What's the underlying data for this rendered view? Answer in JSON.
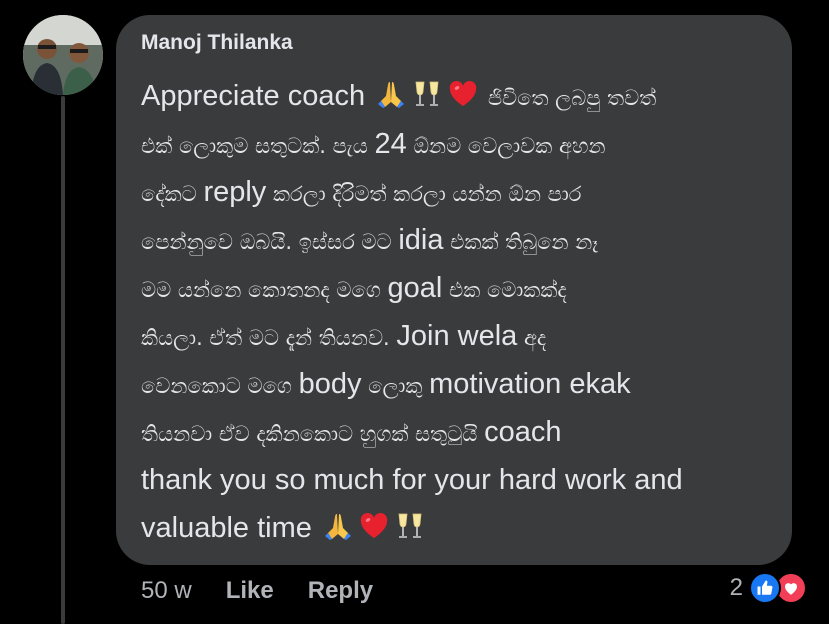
{
  "comment": {
    "author": "Manoj Thilanka",
    "lines": [
      {
        "parts": [
          {
            "type": "text",
            "value": "Appreciate coach "
          },
          {
            "type": "emoji",
            "icon": "folded-hands-icon"
          },
          {
            "type": "emoji",
            "icon": "champagne-glasses-icon"
          },
          {
            "type": "emoji",
            "icon": "red-heart-icon"
          },
          {
            "type": "sin",
            "value": "  ජිවිතෙ ලබපු තවත්"
          }
        ]
      },
      {
        "parts": [
          {
            "type": "sin",
            "value": "එක් ලොකුම සතුටක්.  පැය "
          },
          {
            "type": "text",
            "value": "24"
          },
          {
            "type": "sin",
            "value": " ඕනම වෙලාවක අහන"
          }
        ]
      },
      {
        "parts": [
          {
            "type": "sin",
            "value": "දේකට "
          },
          {
            "type": "text",
            "value": "reply"
          },
          {
            "type": "sin",
            "value": "  කරලා දිරිමත් කරලා  යන්න ඕන පාර"
          }
        ]
      },
      {
        "parts": [
          {
            "type": "sin",
            "value": "පෙන්නුවෙ ඔබයි. ඉස්සර මට "
          },
          {
            "type": "text",
            "value": "idia"
          },
          {
            "type": "sin",
            "value": " එකක් තිබුනෙ නෑ"
          }
        ]
      },
      {
        "parts": [
          {
            "type": "sin",
            "value": "මම යන්නෙ කොතනද මගෙ "
          },
          {
            "type": "text",
            "value": "goal"
          },
          {
            "type": "sin",
            "value": "  එක මොකක්ද"
          }
        ]
      },
      {
        "parts": [
          {
            "type": "sin",
            "value": "කියලා. ඒත් මට දැන් තියනව.  "
          },
          {
            "type": "text",
            "value": "Join wela"
          },
          {
            "type": "sin",
            "value": " අද"
          }
        ]
      },
      {
        "parts": [
          {
            "type": "sin",
            "value": "වෙනකොට මගෙ "
          },
          {
            "type": "text",
            "value": "body"
          },
          {
            "type": "sin",
            "value": " ලොකු "
          },
          {
            "type": "text",
            "value": "motivation ekak"
          }
        ]
      },
      {
        "parts": [
          {
            "type": "sin",
            "value": "තියනවා  ඒව දකිනකොට හුගක් සතුටුයි  "
          },
          {
            "type": "text",
            "value": " coach"
          }
        ]
      },
      {
        "parts": [
          {
            "type": "text",
            "value": "thank you so much for  your hard work and"
          }
        ]
      },
      {
        "parts": [
          {
            "type": "text",
            "value": "valuable time "
          },
          {
            "type": "emoji",
            "icon": "folded-hands-icon"
          },
          {
            "type": "emoji",
            "icon": "red-heart-icon"
          },
          {
            "type": "emoji",
            "icon": "champagne-glasses-icon"
          }
        ]
      }
    ]
  },
  "actions": {
    "time": "50 w",
    "like_label": "Like",
    "reply_label": "Reply"
  },
  "reactions": {
    "count": "2",
    "icons": [
      "like-reaction-icon",
      "love-reaction-icon"
    ]
  },
  "colors": {
    "background": "#000000",
    "bubble": "#3a3b3c",
    "text": "#e4e6eb",
    "secondary_text": "#b0b3b8",
    "like_blue": "#1877f2",
    "love_red": "#f33e58"
  }
}
